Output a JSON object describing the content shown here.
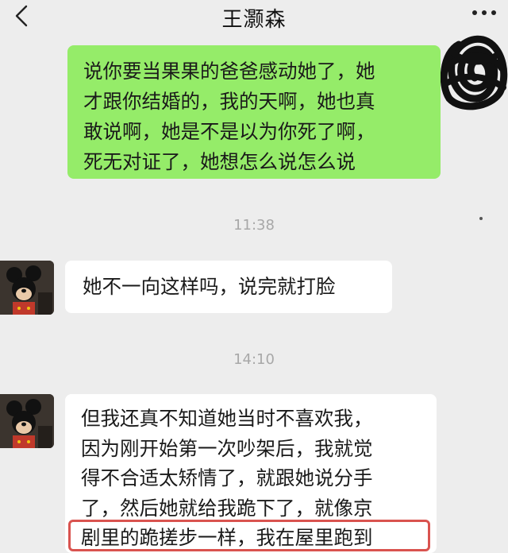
{
  "header": {
    "title": "王灏森",
    "back_icon": "chevron-left-icon",
    "more_icon": "more-dots-icon"
  },
  "messages": [
    {
      "direction": "outgoing",
      "lines": [
        "说你要当果果的爸爸感动她了，她",
        "才跟你结婚的，我的天啊，她也真",
        "敢说啊，她是不是以为你死了啊，",
        "死无对证了，她想怎么说怎么说"
      ]
    },
    {
      "type": "timestamp",
      "text": "11:38"
    },
    {
      "direction": "incoming",
      "lines": [
        "她不一向这样吗，说完就打脸"
      ]
    },
    {
      "type": "timestamp",
      "text": "14:10"
    },
    {
      "direction": "incoming",
      "lines": [
        "但我还真不知道她当时不喜欢我，",
        "因为刚开始第一次吵架后，我就觉",
        "得不合适太矫情了，就跟她说分手",
        "了，然后她就给我跪下了，就像京",
        "剧里的跪搓步一样，我在屋里跑到"
      ]
    }
  ],
  "colors": {
    "background": "#ededed",
    "outgoing_bubble": "#95ec69",
    "incoming_bubble": "#ffffff",
    "highlight_border": "#d9534f",
    "timestamp_text": "#a8a8a8"
  }
}
